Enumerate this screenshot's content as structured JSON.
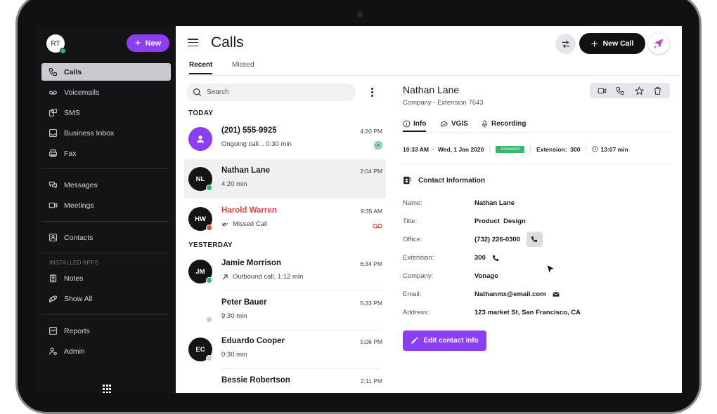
{
  "sidebar": {
    "avatar_initials": "RT",
    "new_button": "New",
    "items": [
      {
        "label": "Calls",
        "icon": "phone-icon",
        "active": true
      },
      {
        "label": "Voicemails",
        "icon": "voicemail-icon"
      },
      {
        "label": "SMS",
        "icon": "sms-icon"
      },
      {
        "label": "Business Inbox",
        "icon": "inbox-icon"
      },
      {
        "label": "Fax",
        "icon": "fax-icon"
      },
      {
        "label": "Messages",
        "icon": "messages-icon"
      },
      {
        "label": "Meetings",
        "icon": "video-icon"
      },
      {
        "label": "Contacts",
        "icon": "contacts-icon"
      },
      {
        "label": "Notes",
        "icon": "notes-icon"
      },
      {
        "label": "Show All",
        "icon": "apps-icon"
      },
      {
        "label": "Reports",
        "icon": "reports-icon"
      },
      {
        "label": "Admin",
        "icon": "admin-icon"
      }
    ],
    "installed_apps_label": "INSTALLED APPS"
  },
  "header": {
    "title": "Calls",
    "new_call_button": "New Call",
    "tabs": [
      {
        "label": "Recent",
        "active": true
      },
      {
        "label": "Missed",
        "active": false
      }
    ]
  },
  "call_list": {
    "search_placeholder": "Search",
    "groups": [
      {
        "label": "TODAY"
      },
      {
        "label": "YESTERDAY"
      }
    ],
    "calls": [
      {
        "name": "(201) 555-9925",
        "detail": "Ongoing call... 0:30 min",
        "time": "4:20 PM",
        "initials": "",
        "status": "ongoing"
      },
      {
        "name": "Nathan Lane",
        "detail": "4:20 min",
        "time": "2:04 PM",
        "initials": "NL",
        "status": "online",
        "selected": true
      },
      {
        "name": "Harold Warren",
        "detail": "Missed Call",
        "time": "9:35 AM",
        "initials": "HW",
        "status": "busy",
        "missed": true
      },
      {
        "name": "Jamie Morrison",
        "detail": "Outbound call, 1:12 min",
        "time": "6:34 PM",
        "initials": "JM",
        "status": "online"
      },
      {
        "name": "Peter Bauer",
        "detail": "9:30 min",
        "time": "5:33 PM",
        "initials": "",
        "status": "offline"
      },
      {
        "name": "Eduardo Cooper",
        "detail": "0:30 min",
        "time": "5:06 PM",
        "initials": "EC",
        "status": "offline"
      },
      {
        "name": "Bessie Robertson",
        "detail": "",
        "time": "2:11 PM",
        "initials": "",
        "status": ""
      }
    ]
  },
  "detail": {
    "name": "Nathan Lane",
    "subtitle": "Company -  Extension 7643",
    "tabs": [
      {
        "label": "Info",
        "active": true
      },
      {
        "label": "VGIS"
      },
      {
        "label": "Recording"
      }
    ],
    "meta": {
      "time": "10:33 AM",
      "date": "Wed, 1 Jan 2020",
      "status_badge": "Answered",
      "extension": "Extension:  300",
      "duration": "13:07 min"
    },
    "contact_heading": "Contact Information",
    "fields": [
      {
        "label": "Name:",
        "value": "Nathan Lane"
      },
      {
        "label": "Title:",
        "value": "Product  Design"
      },
      {
        "label": "Office:",
        "value": "(732) 226-0300"
      },
      {
        "label": "Extension:",
        "value": "300"
      },
      {
        "label": "Company:",
        "value": "Vonage"
      },
      {
        "label": "Email:",
        "value": "Nathanmx@email.com"
      },
      {
        "label": "Address:",
        "value": "123 market St, San Francisco, CA"
      }
    ],
    "edit_button": "Edit contact info"
  },
  "colors": {
    "accent": "#8b3ef4",
    "online": "#30b46c",
    "missed": "#e0483e",
    "answered_badge": "#3ab76a"
  }
}
